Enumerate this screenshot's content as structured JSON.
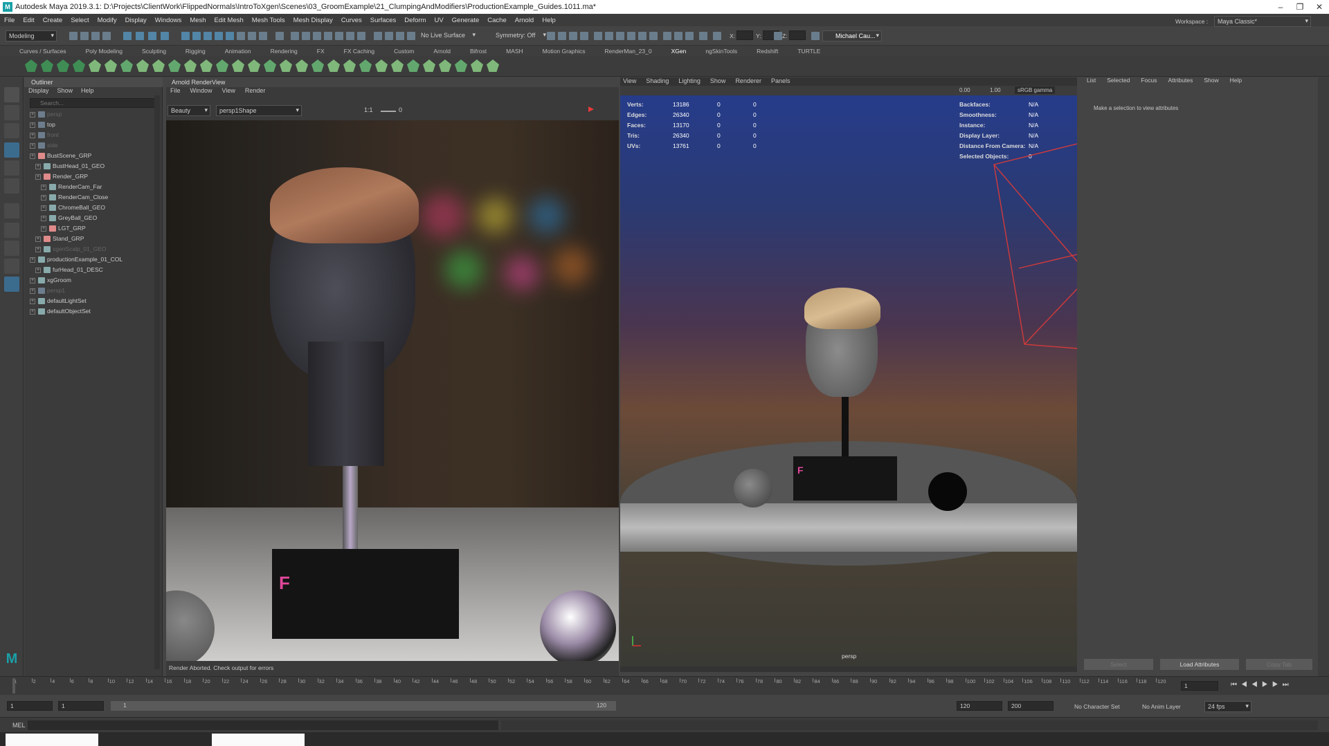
{
  "window": {
    "title": "Autodesk Maya 2019.3.1: D:\\Projects\\ClientWork\\FlippedNormals\\IntroToXgen\\Scenes\\03_GroomExample\\21_ClumpingAndModifiers\\ProductionExample_Guides.1011.ma*",
    "logo": "M",
    "minimize": "–",
    "restore": "❐",
    "close": "✕"
  },
  "menu": [
    "File",
    "Edit",
    "Create",
    "Select",
    "Modify",
    "Display",
    "Windows",
    "Mesh",
    "Edit Mesh",
    "Mesh Tools",
    "Mesh Display",
    "Curves",
    "Surfaces",
    "Deform",
    "UV",
    "Generate",
    "Cache",
    "Arnold",
    "Help"
  ],
  "status": {
    "mode": "Modeling",
    "live_surface": "No Live Surface",
    "symmetry": "Symmetry: Off",
    "user": "Michael Cau...",
    "workspace_label": "Workspace :",
    "workspace": "Maya Classic*",
    "x_label": "X:",
    "y_label": "Y:",
    "z_label": "Z:"
  },
  "shelf_tabs": [
    "Curves / Surfaces",
    "Poly Modeling",
    "Sculpting",
    "Rigging",
    "Animation",
    "Rendering",
    "FX",
    "FX Caching",
    "Custom",
    "Arnold",
    "Bifrost",
    "MASH",
    "Motion Graphics",
    "RenderMan_23_0",
    "XGen",
    "ngSkinTools",
    "Redshift",
    "TURTLE"
  ],
  "shelf_active": "XGen",
  "outliner": {
    "title": "Outliner",
    "menu": [
      "Display",
      "Show",
      "Help"
    ],
    "search_placeholder": "Search...",
    "rows": [
      {
        "label": "persp",
        "depth": 0,
        "dim": true
      },
      {
        "label": "top",
        "depth": 0,
        "dim": false
      },
      {
        "label": "front",
        "depth": 0,
        "dim": true
      },
      {
        "label": "side",
        "depth": 0,
        "dim": true
      },
      {
        "label": "BustScene_GRP",
        "depth": 0,
        "dim": false
      },
      {
        "label": "BustHead_01_GEO",
        "depth": 1,
        "dim": false
      },
      {
        "label": "Render_GRP",
        "depth": 1,
        "dim": false
      },
      {
        "label": "RenderCam_Far",
        "depth": 2,
        "dim": false
      },
      {
        "label": "RenderCam_Close",
        "depth": 2,
        "dim": false
      },
      {
        "label": "ChromeBall_GEO",
        "depth": 2,
        "dim": false
      },
      {
        "label": "GreyBall_GEO",
        "depth": 2,
        "dim": false
      },
      {
        "label": "LGT_GRP",
        "depth": 2,
        "dim": false
      },
      {
        "label": "Stand_GRP",
        "depth": 1,
        "dim": false
      },
      {
        "label": "xgenScalp_01_GEO",
        "depth": 1,
        "dim": true
      },
      {
        "label": "productionExample_01_COL",
        "depth": 0,
        "dim": false
      },
      {
        "label": "furHead_01_DESC",
        "depth": 1,
        "dim": false
      },
      {
        "label": "xgGroom",
        "depth": 0,
        "dim": false
      },
      {
        "label": "persp1",
        "depth": 0,
        "dim": true
      },
      {
        "label": "defaultLightSet",
        "depth": 0,
        "dim": false
      },
      {
        "label": "defaultObjectSet",
        "depth": 0,
        "dim": false
      }
    ]
  },
  "arnold": {
    "title": "Arnold RenderView",
    "menu": [
      "File",
      "Window",
      "View",
      "Render"
    ],
    "aov": "Beauty",
    "camera": "persp1Shape",
    "ratio": "1:1",
    "exposure": "0",
    "status": "Render Aborted. Check output for errors",
    "badge": "F"
  },
  "viewport": {
    "menu": [
      "View",
      "Shading",
      "Lighting",
      "Show",
      "Renderer",
      "Panels"
    ],
    "gamma": "sRGB gamma",
    "val1": "0.00",
    "val2": "1.00",
    "camera_label": "persp",
    "badge": "F",
    "hud_left": [
      {
        "k": "Verts:",
        "a": "13186",
        "b": "0",
        "c": "0"
      },
      {
        "k": "Edges:",
        "a": "26340",
        "b": "0",
        "c": "0"
      },
      {
        "k": "Faces:",
        "a": "13170",
        "b": "0",
        "c": "0"
      },
      {
        "k": "Tris:",
        "a": "26340",
        "b": "0",
        "c": "0"
      },
      {
        "k": "UVs:",
        "a": "13761",
        "b": "0",
        "c": "0"
      }
    ],
    "hud_right": [
      {
        "k": "Backfaces:",
        "v": "N/A"
      },
      {
        "k": "Smoothness:",
        "v": "N/A"
      },
      {
        "k": "Instance:",
        "v": "N/A"
      },
      {
        "k": "Display Layer:",
        "v": "N/A"
      },
      {
        "k": "Distance From Camera:",
        "v": "N/A"
      },
      {
        "k": "Selected Objects:",
        "v": "0"
      }
    ]
  },
  "attr": {
    "menu": [
      "List",
      "Selected",
      "Focus",
      "Attributes",
      "Show",
      "Help"
    ],
    "message": "Make a selection to view attributes",
    "buttons": [
      "Select",
      "Load Attributes",
      "Copy Tab"
    ]
  },
  "timeline": {
    "ticks": [
      "1",
      "2",
      "4",
      "6",
      "8",
      "10",
      "12",
      "14",
      "16",
      "18",
      "20",
      "22",
      "24",
      "26",
      "28",
      "30",
      "32",
      "34",
      "36",
      "38",
      "40",
      "42",
      "44",
      "46",
      "48",
      "50",
      "52",
      "54",
      "56",
      "58",
      "60",
      "62",
      "64",
      "66",
      "68",
      "70",
      "72",
      "74",
      "76",
      "78",
      "80",
      "82",
      "84",
      "86",
      "88",
      "90",
      "92",
      "94",
      "96",
      "98",
      "100",
      "102",
      "104",
      "106",
      "108",
      "110",
      "112",
      "114",
      "116",
      "118",
      "120"
    ],
    "current": "1"
  },
  "range": {
    "start": "1",
    "anim_start": "1",
    "slider_start": "1",
    "slider_end": "120",
    "end": "120",
    "anim_end": "200",
    "char_set": "No Character Set",
    "anim_layer": "No Anim Layer",
    "fps": "24 fps"
  },
  "cmd": {
    "label": "MEL"
  },
  "colors": {
    "accent": "#5285a6",
    "active_tool": "#3b6c8e",
    "render_red": "#e83a3a",
    "pink_badge": "#e0479b"
  }
}
